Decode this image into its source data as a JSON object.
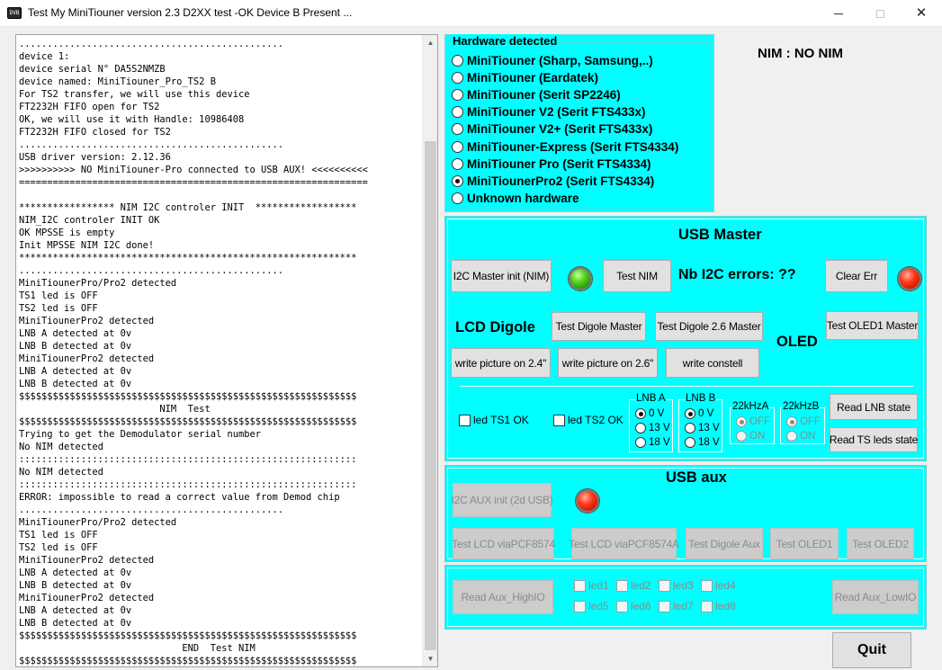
{
  "window": {
    "title": "Test My MiniTiouner version 2.3 D2XX test -OK Device B Present ...",
    "icon_text": "DVB",
    "minimize_icon": "minimize-icon",
    "maximize_icon": "maximize-icon",
    "close_glyph": "✕"
  },
  "log": {
    "lines": [
      "...............................................",
      "device 1:",
      "device serial N° DA5S2NMZB",
      "device named: MiniTiouner_Pro_TS2 B",
      "For TS2 transfer, we will use this device",
      "FT2232H FIFO open for TS2",
      "OK, we will use it with Handle: 10986408",
      "FT2232H FIFO closed for TS2",
      "...............................................",
      "USB driver version: 2.12.36",
      ">>>>>>>>>> NO MiniTiouner-Pro connected to USB AUX! <<<<<<<<<<",
      "==============================================================",
      "",
      "***************** NIM I2C controler INIT  ******************",
      "NIM_I2C controler INIT OK",
      "OK MPSSE is empty",
      "Init MPSSE NIM I2C done!",
      "************************************************************",
      "...............................................",
      "MiniTiounerPro/Pro2 detected",
      "TS1 led is OFF",
      "TS2 led is OFF",
      "MiniTiounerPro2 detected",
      "LNB A detected at 0v",
      "LNB B detected at 0v",
      "MiniTiounerPro2 detected",
      "LNB A detected at 0v",
      "LNB B detected at 0v",
      "$$$$$$$$$$$$$$$$$$$$$$$$$$$$$$$$$$$$$$$$$$$$$$$$$$$$$$$$$$$$",
      "                         NIM  Test",
      "$$$$$$$$$$$$$$$$$$$$$$$$$$$$$$$$$$$$$$$$$$$$$$$$$$$$$$$$$$$$",
      "Trying to get the Demodulator serial number",
      "No NIM detected",
      "::::::::::::::::::::::::::::::::::::::::::::::::::::::::::::",
      "No NIM detected",
      "::::::::::::::::::::::::::::::::::::::::::::::::::::::::::::",
      "ERROR: impossible to read a correct value from Demod chip",
      "...............................................",
      "MiniTiounerPro/Pro2 detected",
      "TS1 led is OFF",
      "TS2 led is OFF",
      "MiniTiounerPro2 detected",
      "LNB A detected at 0v",
      "LNB B detected at 0v",
      "MiniTiounerPro2 detected",
      "LNB A detected at 0v",
      "LNB B detected at 0v",
      "$$$$$$$$$$$$$$$$$$$$$$$$$$$$$$$$$$$$$$$$$$$$$$$$$$$$$$$$$$$$",
      "                             END  Test NIM",
      "$$$$$$$$$$$$$$$$$$$$$$$$$$$$$$$$$$$$$$$$$$$$$$$$$$$$$$$$$$$$"
    ],
    "scroll_up_glyph": "▲",
    "scroll_down_glyph": "▼"
  },
  "hardware": {
    "legend": "Hardware detected",
    "options": [
      {
        "label": "MiniTiouner (Sharp, Samsung,..)",
        "selected": false
      },
      {
        "label": "MiniTiouner (Eardatek)",
        "selected": false
      },
      {
        "label": "MiniTiouner (Serit SP2246)",
        "selected": false
      },
      {
        "label": "MiniTiouner V2 (Serit FTS433x)",
        "selected": false
      },
      {
        "label": "MiniTiouner V2+ (Serit FTS433x)",
        "selected": false
      },
      {
        "label": "MiniTiouner-Express (Serit FTS4334)",
        "selected": false
      },
      {
        "label": "MiniTiouner Pro  (Serit FTS4334)",
        "selected": false
      },
      {
        "label": "MiniTiounerPro2 (Serit FTS4334)",
        "selected": true
      },
      {
        "label": "Unknown hardware",
        "selected": false
      }
    ]
  },
  "nim_status": "NIM : NO NIM",
  "usb_master": {
    "title": "USB Master",
    "i2c_init_label": "I2C Master init (NIM)",
    "test_nim_label": "Test NIM",
    "nb_errors_label": "Nb I2C errors:  ??",
    "clear_err_label": "Clear Err",
    "i2c_led_color": "#1f8a06",
    "err_led_color": "#c40f00",
    "lcd_title": "LCD Digole",
    "test_digole_master_label": "Test Digole Master",
    "test_digole_26_label": "Test Digole 2.6 Master",
    "oled_title": "OLED",
    "test_oled1_master_label": "Test OLED1 Master",
    "write_24_label": "write picture on 2.4''",
    "write_26_label": "write picture on 2.6''",
    "write_constell_label": "write constell",
    "led_ts1_label": "led TS1 OK",
    "led_ts2_label": "led TS2 OK",
    "lnb_a": {
      "legend": "LNB A",
      "options": [
        "0 V",
        "13 V",
        "18 V"
      ],
      "selected": "0 V"
    },
    "lnb_b": {
      "legend": "LNB B",
      "options": [
        "0 V",
        "13 V",
        "18 V"
      ],
      "selected": "0 V"
    },
    "khz_a": {
      "legend": "22kHzA",
      "options": [
        "OFF",
        "ON"
      ],
      "selected": "OFF"
    },
    "khz_b": {
      "legend": "22kHzB",
      "options": [
        "OFF",
        "ON"
      ],
      "selected": "OFF"
    },
    "read_lnb_label": "Read LNB state",
    "read_ts_leds_label": "Read TS leds state"
  },
  "usb_aux": {
    "title": "USB aux",
    "i2c_aux_init_label": "I2C AUX init (2d USB)",
    "aux_led_color": "#c40f00",
    "test_lcd_pcf8574_label": "Test LCD viaPCF8574",
    "test_lcd_pcf8574a_label": "Test LCD viaPCF8574A",
    "test_digole_aux_label": "Test Digole Aux",
    "test_oled1_label": "Test OLED1",
    "test_oled2_label": "Test OLED2",
    "read_aux_high_label": "Read Aux_HighIO",
    "read_aux_low_label": "Read Aux_LowIO",
    "leds": [
      "led1",
      "led2",
      "led3",
      "led4",
      "led5",
      "led6",
      "led7",
      "led8"
    ]
  },
  "quit_label": "Quit",
  "colors": {
    "panel_cyan": "#00ffff",
    "button_face": "#e1e1e1",
    "disabled_text": "#8b8b8b"
  }
}
